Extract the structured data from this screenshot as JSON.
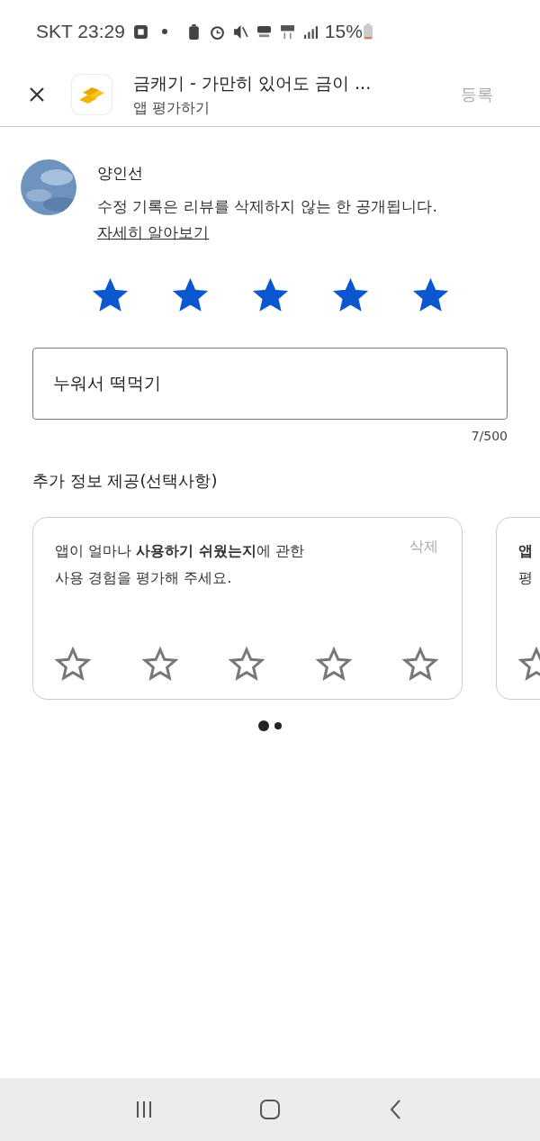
{
  "status_bar": {
    "carrier_time": "SKT 23:29",
    "battery": "15%"
  },
  "header": {
    "title": "금캐기 - 가만히 있어도 금이 ...",
    "subtitle": "앱 평가하기",
    "submit": {
      "label": "등록",
      "disabled": true
    }
  },
  "user": {
    "name": "양인선",
    "notice": "수정 기록은 리뷰를 삭제하지 않는 한 공개됩니다.",
    "link": "자세히 알아보기"
  },
  "rating": {
    "stars": 5
  },
  "review": {
    "value": "누워서 떡먹기",
    "counter": "7/500"
  },
  "extra_heading": "추가 정보 제공(선택사항)",
  "cards": [
    {
      "lines": [
        "앱이 얼마나 **사용하기 쉬웠는지**에 관한",
        "사용 경험을 평가해 주세요."
      ],
      "delete": "삭제",
      "stars": 0
    },
    {
      "lines": [
        "**앱**",
        "평"
      ]
    }
  ],
  "page_dots": [
    {
      "selected": true
    },
    {
      "selected": false
    }
  ]
}
